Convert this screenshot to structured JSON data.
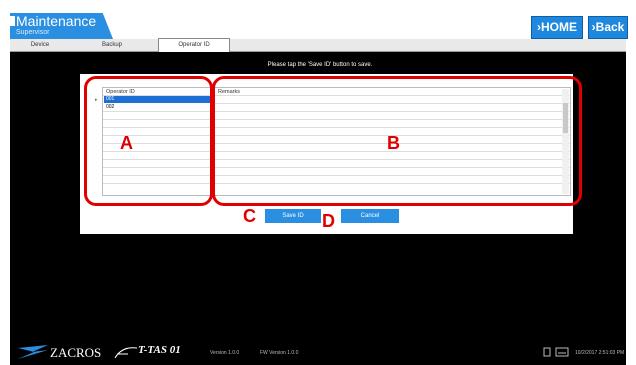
{
  "header": {
    "title": "Maintenance",
    "subtitle": "Supervisor",
    "home_label": "›HOME",
    "back_label": "›Back"
  },
  "tabs": [
    {
      "label": "Device"
    },
    {
      "label": "Backup"
    },
    {
      "label": "Operator ID"
    }
  ],
  "instruction": "Please tap the 'Save ID' button to save.",
  "grid": {
    "left_header": "Operator ID",
    "right_header": "Remarks",
    "rows": [
      {
        "id": "001",
        "selected": true
      },
      {
        "id": "002",
        "selected": false
      }
    ],
    "row_marker": "▸"
  },
  "buttons": {
    "save_id": "Save ID",
    "cancel": "Cancel"
  },
  "annotations": {
    "A": "A",
    "B": "B",
    "C": "C",
    "D": "D"
  },
  "footer": {
    "brand": "ZACROS",
    "product": "T-TAS 01",
    "left_info": "Version 1.0.0",
    "mid_info": "FW Version 1.0.0",
    "datetime": "10/2/2017 2:51:03 PM"
  },
  "colors": {
    "accent": "#2a8fe0",
    "annotation": "#e00000",
    "background": "#000000"
  }
}
